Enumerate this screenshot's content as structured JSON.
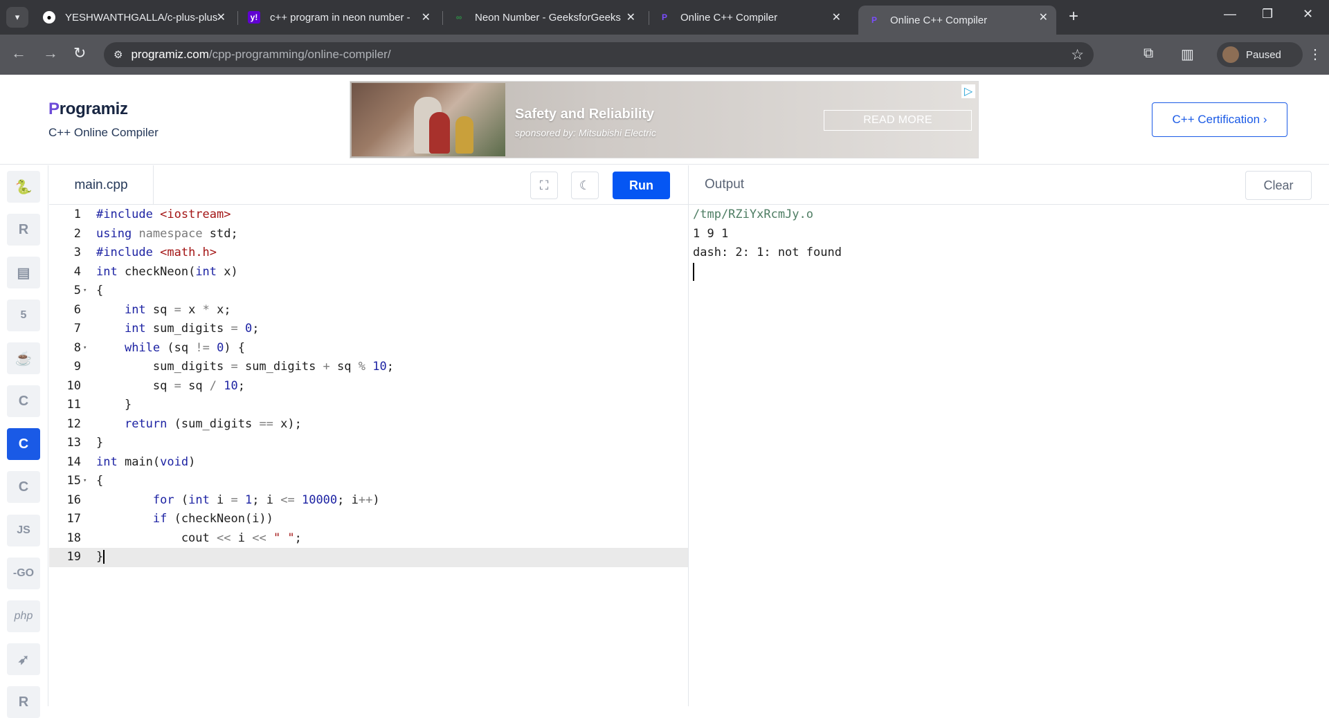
{
  "browser": {
    "tabs": [
      {
        "title": "YESHWANTHGALLA/c-plus-plus",
        "favicon": "github-icon"
      },
      {
        "title": "c++ program in neon number -",
        "favicon": "yahoo-icon"
      },
      {
        "title": "Neon Number - GeeksforGeeks",
        "favicon": "geeksforgeeks-icon"
      },
      {
        "title": "Online C++ Compiler",
        "favicon": "programiz-icon"
      },
      {
        "title": "Online C++ Compiler",
        "favicon": "programiz-icon",
        "active": true
      }
    ],
    "url_host": "programiz.com",
    "url_path": "/cpp-programming/online-compiler/",
    "profile_label": "Paused"
  },
  "header": {
    "logo": "rogramiz",
    "logo_first": "P",
    "subtitle": "C++ Online Compiler",
    "certification_button": "C++ Certification ›"
  },
  "ad": {
    "headline": "Safety and Reliability",
    "sponsor": "sponsored by: Mitsubishi Electric",
    "cta": "READ MORE"
  },
  "languages": [
    {
      "name": "python-icon",
      "label": ""
    },
    {
      "name": "r-icon",
      "label": "R"
    },
    {
      "name": "sql-icon",
      "label": ""
    },
    {
      "name": "html-icon",
      "label": "5"
    },
    {
      "name": "java-icon",
      "label": ""
    },
    {
      "name": "c-icon",
      "label": "C"
    },
    {
      "name": "cpp-icon",
      "label": "C",
      "active": true
    },
    {
      "name": "csharp-icon",
      "label": "C"
    },
    {
      "name": "js-icon",
      "label": "JS"
    },
    {
      "name": "go-icon",
      "label": "-GO"
    },
    {
      "name": "php-icon",
      "label": "php"
    },
    {
      "name": "swift-icon",
      "label": ""
    },
    {
      "name": "rust-icon",
      "label": "R"
    }
  ],
  "editor": {
    "file_name": "main.cpp",
    "run_label": "Run",
    "lines": [
      "#include <iostream>",
      "using namespace std;",
      "#include <math.h>",
      "int checkNeon(int x)",
      "{",
      "    int sq = x * x;",
      "    int sum_digits = 0;",
      "    while (sq != 0) {",
      "        sum_digits = sum_digits + sq % 10;",
      "        sq = sq / 10;",
      "    }",
      "    return (sum_digits == x);",
      "}",
      "int main(void)",
      "{",
      "        for (int i = 1; i <= 10000; i++)",
      "        if (checkNeon(i))",
      "            cout << i << \" \";",
      "}"
    ],
    "fold_lines": [
      5,
      8,
      15
    ],
    "current_line": 19
  },
  "output": {
    "title": "Output",
    "clear_label": "Clear",
    "lines": [
      "/tmp/RZiYxRcmJy.o",
      "1 9 1",
      "dash: 2: 1: not found"
    ]
  }
}
